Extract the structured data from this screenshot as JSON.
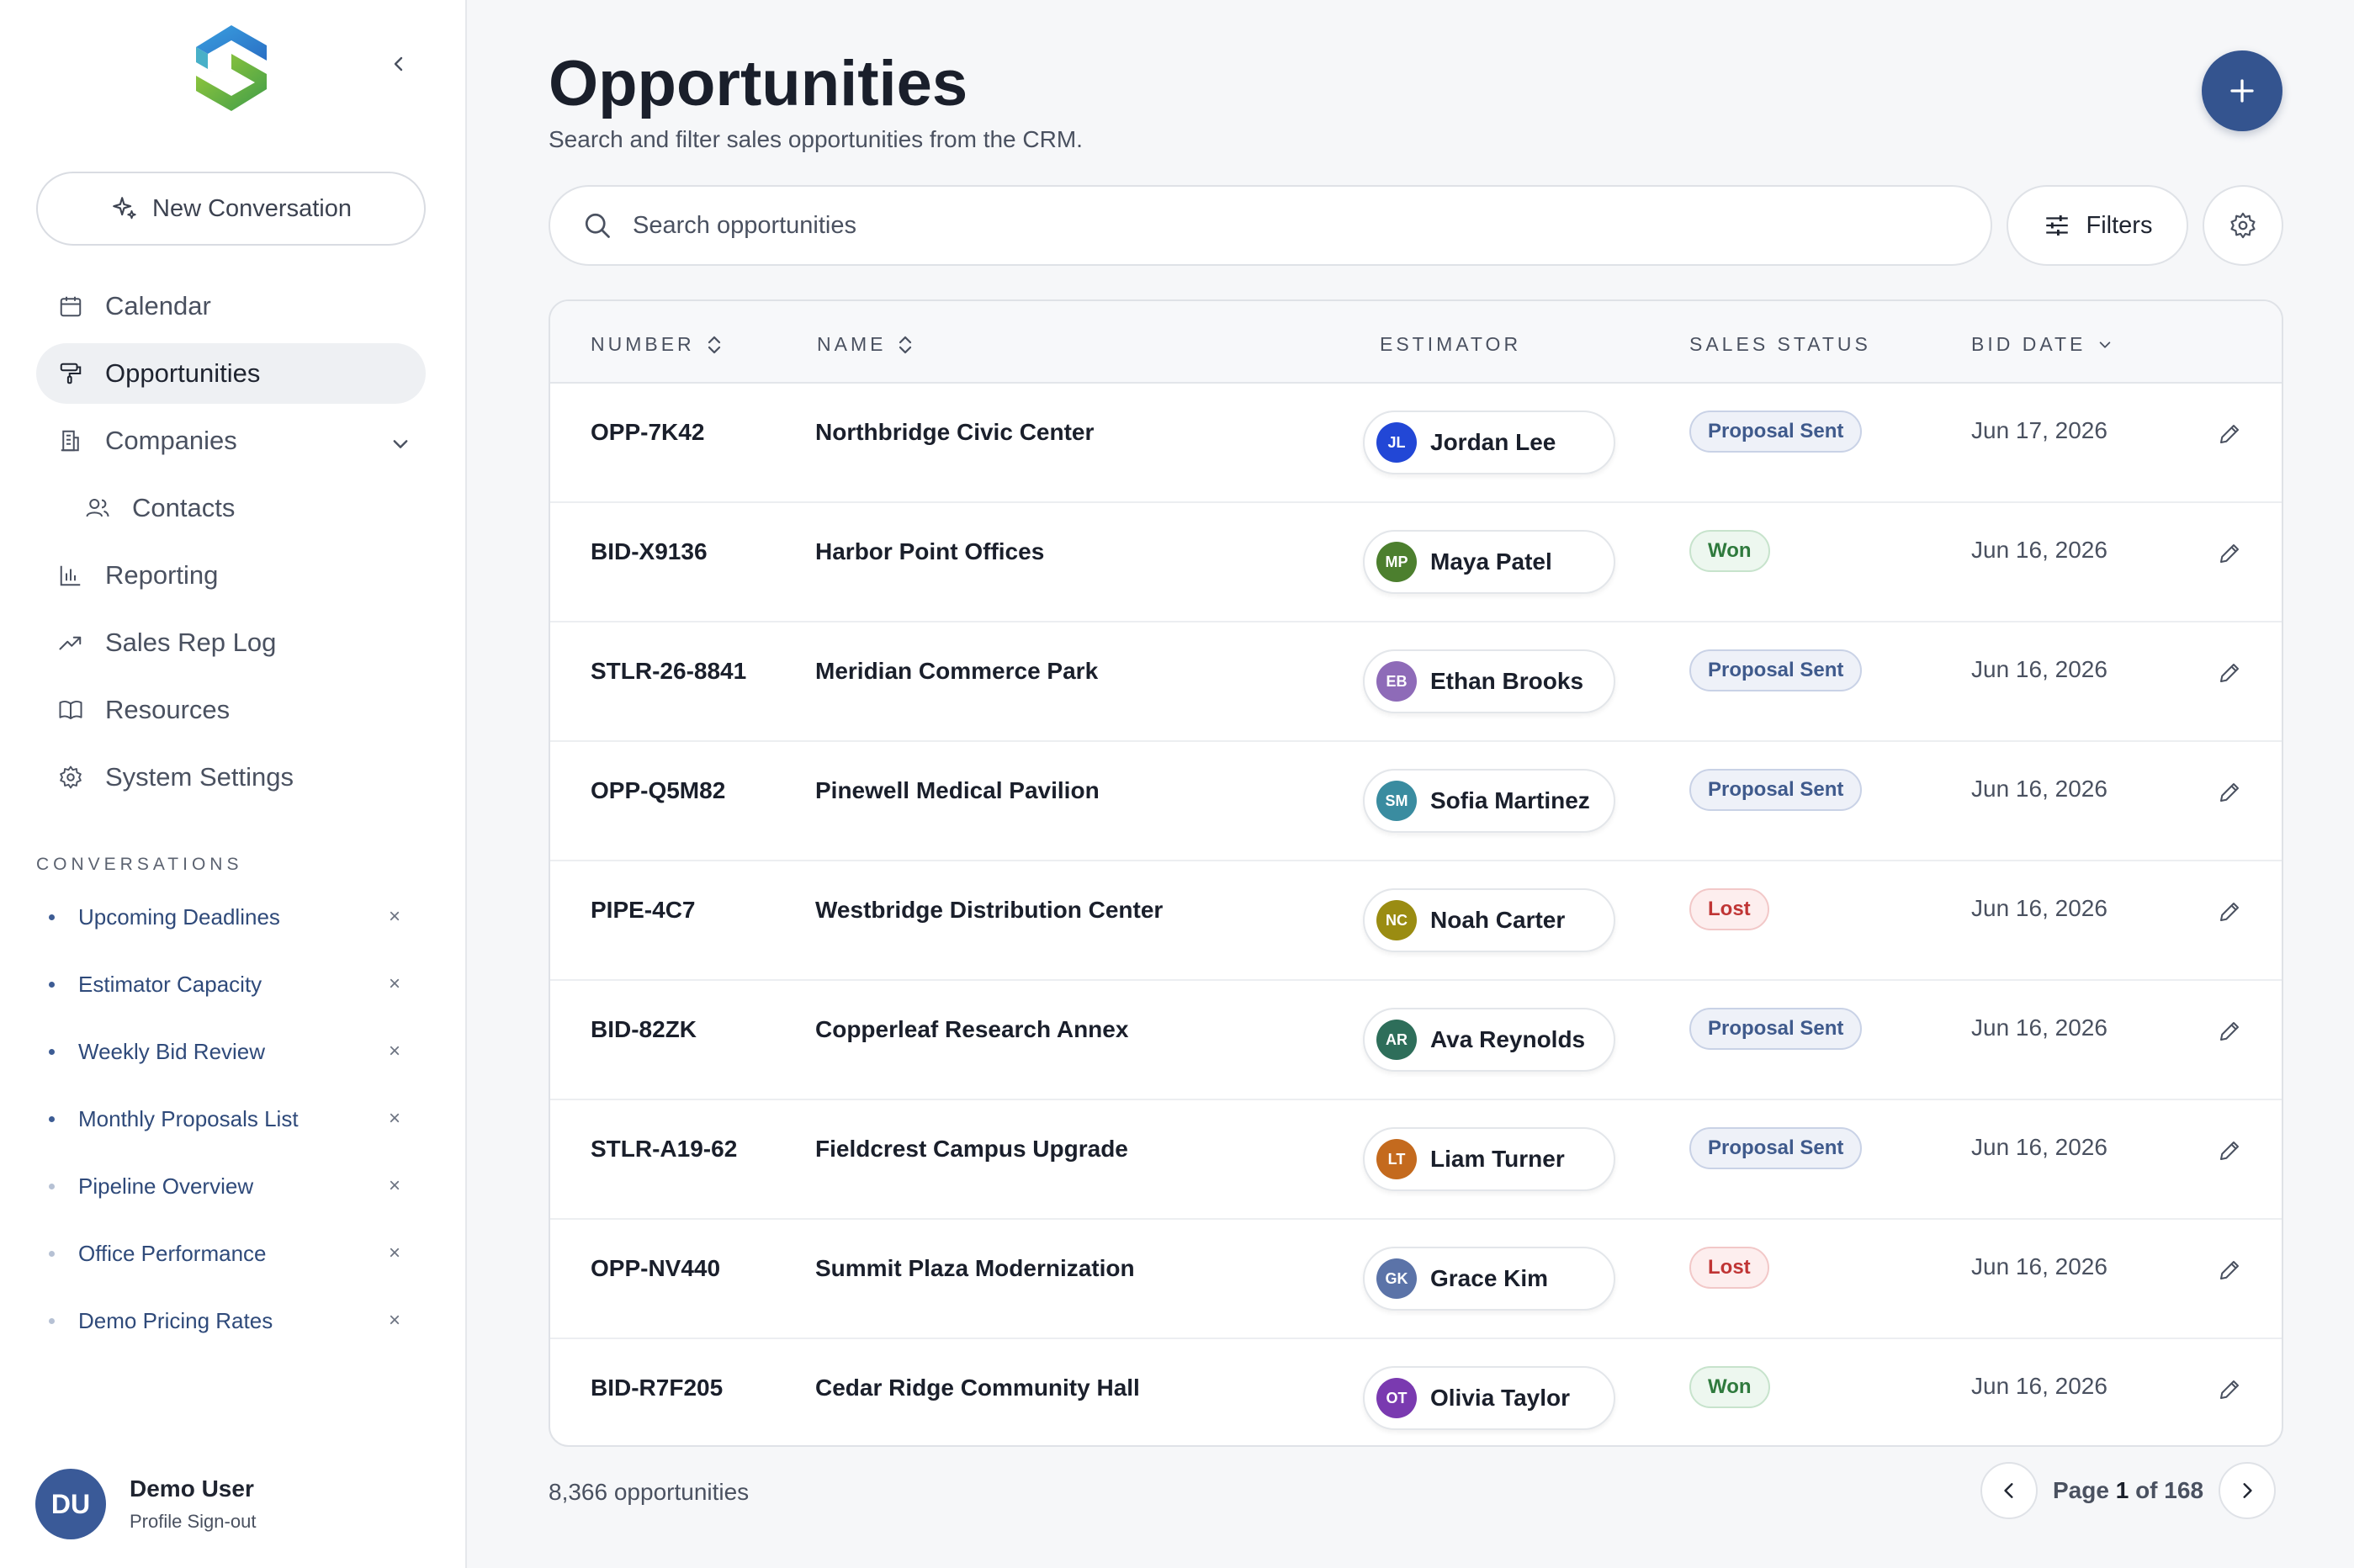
{
  "sidebar": {
    "new_conversation_label": "New Conversation",
    "nav": [
      {
        "label": "Calendar",
        "icon": "calendar-icon"
      },
      {
        "label": "Opportunities",
        "icon": "paint-roller-icon",
        "active": true
      },
      {
        "label": "Companies",
        "icon": "building-icon",
        "expandable": true
      },
      {
        "label": "Contacts",
        "icon": "users-icon",
        "sub": true
      },
      {
        "label": "Reporting",
        "icon": "bar-chart-icon"
      },
      {
        "label": "Sales Rep Log",
        "icon": "trending-up-icon"
      },
      {
        "label": "Resources",
        "icon": "book-icon"
      },
      {
        "label": "System Settings",
        "icon": "gear-icon"
      }
    ],
    "conversations_heading": "CONVERSATIONS",
    "conversations": [
      {
        "label": "Upcoming Deadlines"
      },
      {
        "label": "Estimator Capacity"
      },
      {
        "label": "Weekly Bid Review"
      },
      {
        "label": "Monthly Proposals List"
      },
      {
        "label": "Pipeline Overview",
        "faded": true
      },
      {
        "label": "Office Performance",
        "faded": true
      },
      {
        "label": "Demo Pricing Rates",
        "faded": true
      }
    ],
    "close_glyph": "×",
    "user": {
      "initials": "DU",
      "name": "Demo User",
      "profile_link": "Profile",
      "signout_link": "Sign-out"
    }
  },
  "header": {
    "title": "Opportunities",
    "subtitle": "Search and filter sales opportunities from the CRM."
  },
  "search": {
    "placeholder": "Search opportunities",
    "value": ""
  },
  "toolbar": {
    "filters_label": "Filters"
  },
  "table": {
    "columns": {
      "number": "NUMBER",
      "name": "NAME",
      "estimator": "ESTIMATOR",
      "sales_status": "SALES STATUS",
      "bid_date": "BID DATE"
    },
    "rows": [
      {
        "number": "OPP-7K42",
        "name": "Northbridge Civic Center",
        "estimator": "Jordan Lee",
        "initials": "JL",
        "avatar_color": "#2247d6",
        "status": "Proposal Sent",
        "status_kind": "proposal",
        "bid_date": "Jun 17, 2026"
      },
      {
        "number": "BID-X9136",
        "name": "Harbor Point Offices",
        "estimator": "Maya Patel",
        "initials": "MP",
        "avatar_color": "#4c7f2e",
        "status": "Won",
        "status_kind": "won",
        "bid_date": "Jun 16, 2026"
      },
      {
        "number": "STLR-26-8841",
        "name": "Meridian Commerce Park",
        "estimator": "Ethan Brooks",
        "initials": "EB",
        "avatar_color": "#8e6bb8",
        "status": "Proposal Sent",
        "status_kind": "proposal",
        "bid_date": "Jun 16, 2026"
      },
      {
        "number": "OPP-Q5M82",
        "name": "Pinewell Medical Pavilion",
        "estimator": "Sofia Martinez",
        "initials": "SM",
        "avatar_color": "#3a8ca0",
        "status": "Proposal Sent",
        "status_kind": "proposal",
        "bid_date": "Jun 16, 2026"
      },
      {
        "number": "PIPE-4C7",
        "name": "Westbridge Distribution Center",
        "estimator": "Noah Carter",
        "initials": "NC",
        "avatar_color": "#9a8c12",
        "status": "Lost",
        "status_kind": "lost",
        "bid_date": "Jun 16, 2026"
      },
      {
        "number": "BID-82ZK",
        "name": "Copperleaf Research Annex",
        "estimator": "Ava Reynolds",
        "initials": "AR",
        "avatar_color": "#2e6e5a",
        "status": "Proposal Sent",
        "status_kind": "proposal",
        "bid_date": "Jun 16, 2026"
      },
      {
        "number": "STLR-A19-62",
        "name": "Fieldcrest Campus Upgrade",
        "estimator": "Liam Turner",
        "initials": "LT",
        "avatar_color": "#c46a1e",
        "status": "Proposal Sent",
        "status_kind": "proposal",
        "bid_date": "Jun 16, 2026"
      },
      {
        "number": "OPP-NV440",
        "name": "Summit Plaza Modernization",
        "estimator": "Grace Kim",
        "initials": "GK",
        "avatar_color": "#5b73a8",
        "status": "Lost",
        "status_kind": "lost",
        "bid_date": "Jun 16, 2026"
      },
      {
        "number": "BID-R7F205",
        "name": "Cedar Ridge Community Hall",
        "estimator": "Olivia Taylor",
        "initials": "OT",
        "avatar_color": "#7a3ab0",
        "status": "Won",
        "status_kind": "won",
        "bid_date": "Jun 16, 2026"
      }
    ]
  },
  "footer": {
    "count_text": "8,366 opportunities",
    "page_prefix": "Page",
    "page_current": "1",
    "page_of": "of",
    "page_total": "168"
  },
  "colors": {
    "accent": "#34548f",
    "active_nav_bg": "#eef0f3"
  }
}
